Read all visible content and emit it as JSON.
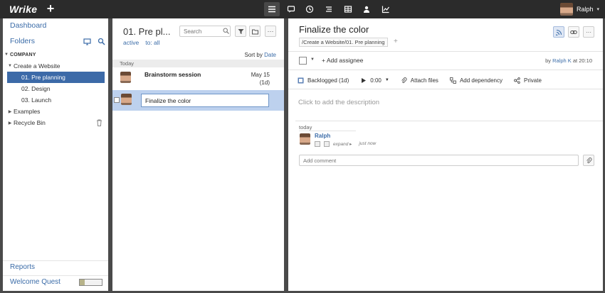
{
  "app": {
    "logo": "Wrike",
    "new_label": "+"
  },
  "topnav": {
    "icons": [
      "menu-icon",
      "chat-icon",
      "clock-icon",
      "list-icon",
      "table-icon",
      "person-icon",
      "chart-icon"
    ],
    "user_name": "Ralph",
    "user_caret": "▾"
  },
  "sidebar": {
    "dashboard": "Dashboard",
    "folders": "Folders",
    "company": "COMPANY",
    "tree": [
      {
        "label": "Create a Website",
        "expanded": true
      },
      {
        "label": "01. Pre planning",
        "selected": true
      },
      {
        "label": "02. Design"
      },
      {
        "label": "03. Launch"
      },
      {
        "label": "Examples",
        "expanded": false
      },
      {
        "label": "Recycle Bin",
        "expanded": false
      }
    ],
    "reports": "Reports",
    "welcome_quest": "Welcome Quest",
    "quest_progress": 0.22
  },
  "tasklist": {
    "title": "01. Pre pl...",
    "filter_status": "active",
    "filter_to": "to: all",
    "search_placeholder": "Search",
    "more_label": "···",
    "sort_label": "Sort by",
    "sort_value": "Date",
    "group_today": "Today",
    "tasks": [
      {
        "title": "Brainstorm session",
        "date": "May 15",
        "duration": "(1d)"
      },
      {
        "title": "Finalize the color",
        "editing": true
      }
    ]
  },
  "task_detail": {
    "title": "Finalize the color",
    "path": "/Create a Website/01. Pre planning",
    "path_add": "+",
    "add_assignee": "Add assignee",
    "by_prefix": "by",
    "by_user": "Ralph K",
    "by_time": "at 20:10",
    "status": "Backlogged (1d)",
    "time_value": "0:00",
    "attach_files": "Attach files",
    "add_dependency": "Add dependency",
    "private": "Private",
    "description_placeholder": "Click to add the description",
    "stream_today": "today",
    "stream_user": "Ralph",
    "stream_expand": "expand",
    "stream_time": "just now",
    "comment_placeholder": "Add comment",
    "more_label": "···"
  },
  "colors": {
    "link": "#3b6ca8",
    "selected": "#3c6aa8",
    "topbar": "#2b2b2b"
  }
}
